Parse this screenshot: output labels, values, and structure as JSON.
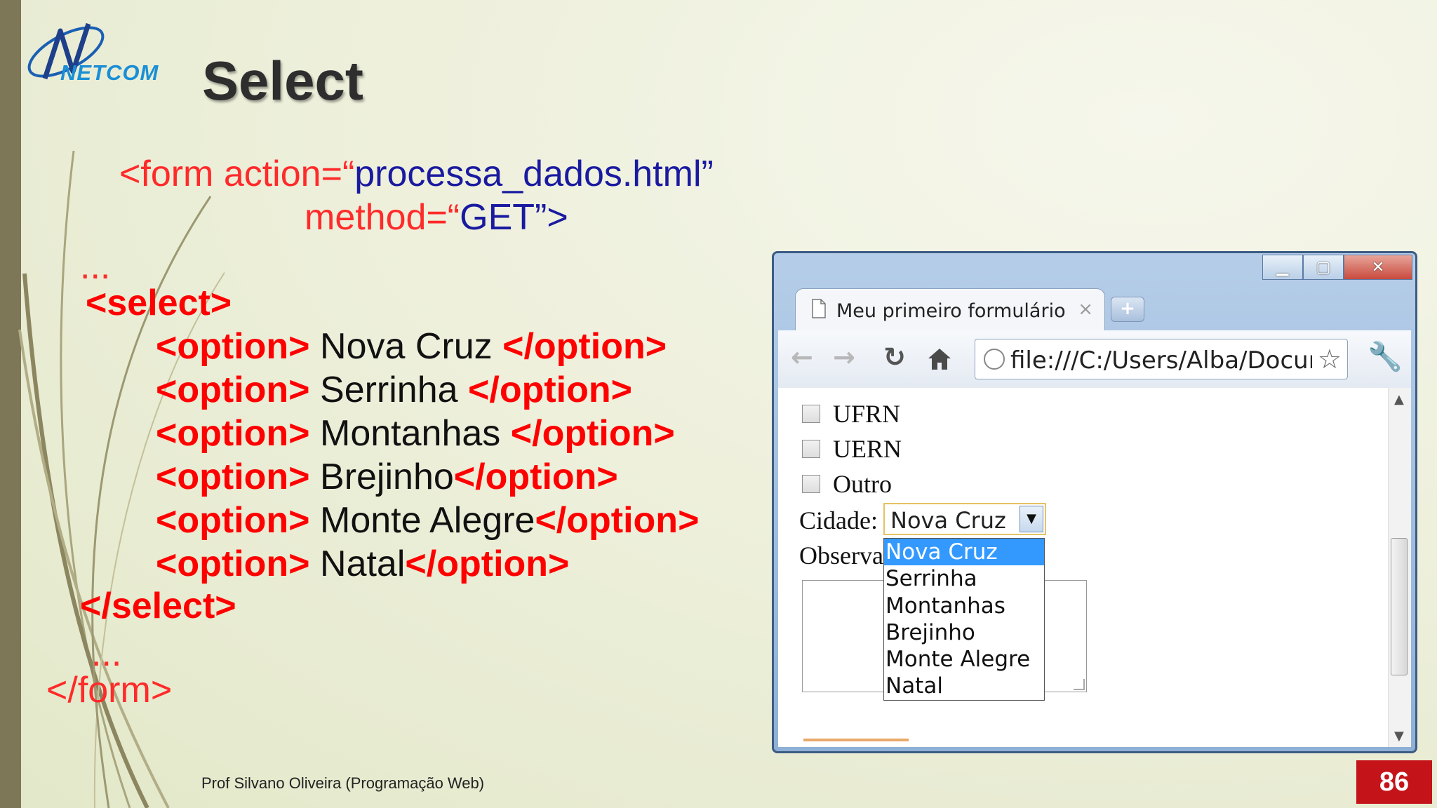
{
  "slide": {
    "logo_text": "NETCOM",
    "title": "Select",
    "footer": "Prof Silvano Oliveira (Programação Web)",
    "page_number": "86"
  },
  "code": {
    "form_open_1a": "<form action=“",
    "form_open_1b": "processa_dados.html",
    "form_open_1c": "”",
    "form_open_2a": "method=“",
    "form_open_2b": "GET",
    "form_open_2c": "”>",
    "ellipsis_1": "...",
    "select_open": "<select>",
    "options": [
      {
        "open": "<option>",
        "text": " Nova Cruz ",
        "close": "</option>"
      },
      {
        "open": "<option>",
        "text": " Serrinha ",
        "close": "</option>"
      },
      {
        "open": "<option>",
        "text": " Montanhas ",
        "close": "</option>"
      },
      {
        "open": "<option>",
        "text": " Brejinho",
        "close": "</option>"
      },
      {
        "open": "<option>",
        "text": " Monte Alegre",
        "close": "</option>"
      },
      {
        "open": "<option>",
        "text": " Natal",
        "close": "</option>"
      }
    ],
    "select_close": "</select>",
    "ellipsis_2": "...",
    "form_close": "</form>"
  },
  "browser": {
    "tab_title": "Meu primeiro formulário",
    "tab_close": "×",
    "new_tab": "+",
    "url": "file:///C:/Users/Alba/Docum",
    "controls": {
      "minimize": "▁",
      "maximize": "▢",
      "close": "✕"
    },
    "checkboxes": [
      "UFRN",
      "UERN",
      "Outro"
    ],
    "cidade_label": "Cidade:",
    "select_value": "Nova Cruz",
    "obs_label": "Observa",
    "dropdown_options": [
      "Nova Cruz",
      "Serrinha",
      "Montanhas",
      "Brejinho",
      "Monte Alegre",
      "Natal"
    ],
    "selected_index": 0
  },
  "colors": {
    "tag_red": "#ff0000",
    "value_blue": "#1a1aa0",
    "page_box": "#c4141a",
    "selected_option": "#3399ff"
  }
}
